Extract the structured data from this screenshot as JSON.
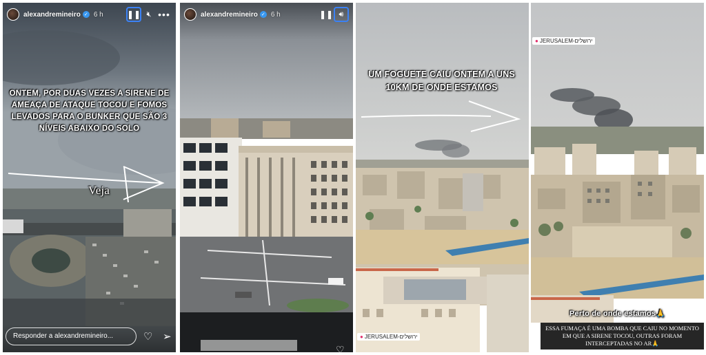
{
  "username": "alexandremineiro",
  "stories": [
    {
      "time": "6 h",
      "caption": "Ontem, por duas vezes a sirene de ameaça de ataque tocou e fomos levados para o bunker que são 3 níveis abaixo do solo",
      "annotation": "Veja",
      "reply_placeholder": "Responder a alexandremineiro..."
    },
    {
      "time": "6 h"
    },
    {
      "caption": "Um foguete caiu ontem a uns 10km de onde estamos",
      "location": "JERUSALEM-ירושלים"
    },
    {
      "location": "JERUSALEM-ירושלים",
      "caption_top": "Perto de onde estamos🙏",
      "caption_bottom": "ESSA FUMAÇA É UMA BOMBA QUE CAIU NO MOMENTO EM QUE A SIRENE TOCOU, OUTRAS FORAM INTERCEPTADAS NO AR🙏"
    }
  ],
  "icons": [
    "pause-icon",
    "mute-icon",
    "more-icon",
    "sound-icon",
    "heart-icon",
    "send-icon",
    "verified-icon",
    "location-pin-icon"
  ],
  "colors": {
    "focus_outline": "#3b82f6",
    "verified": "#3897f0",
    "pin": "#e1306c"
  }
}
